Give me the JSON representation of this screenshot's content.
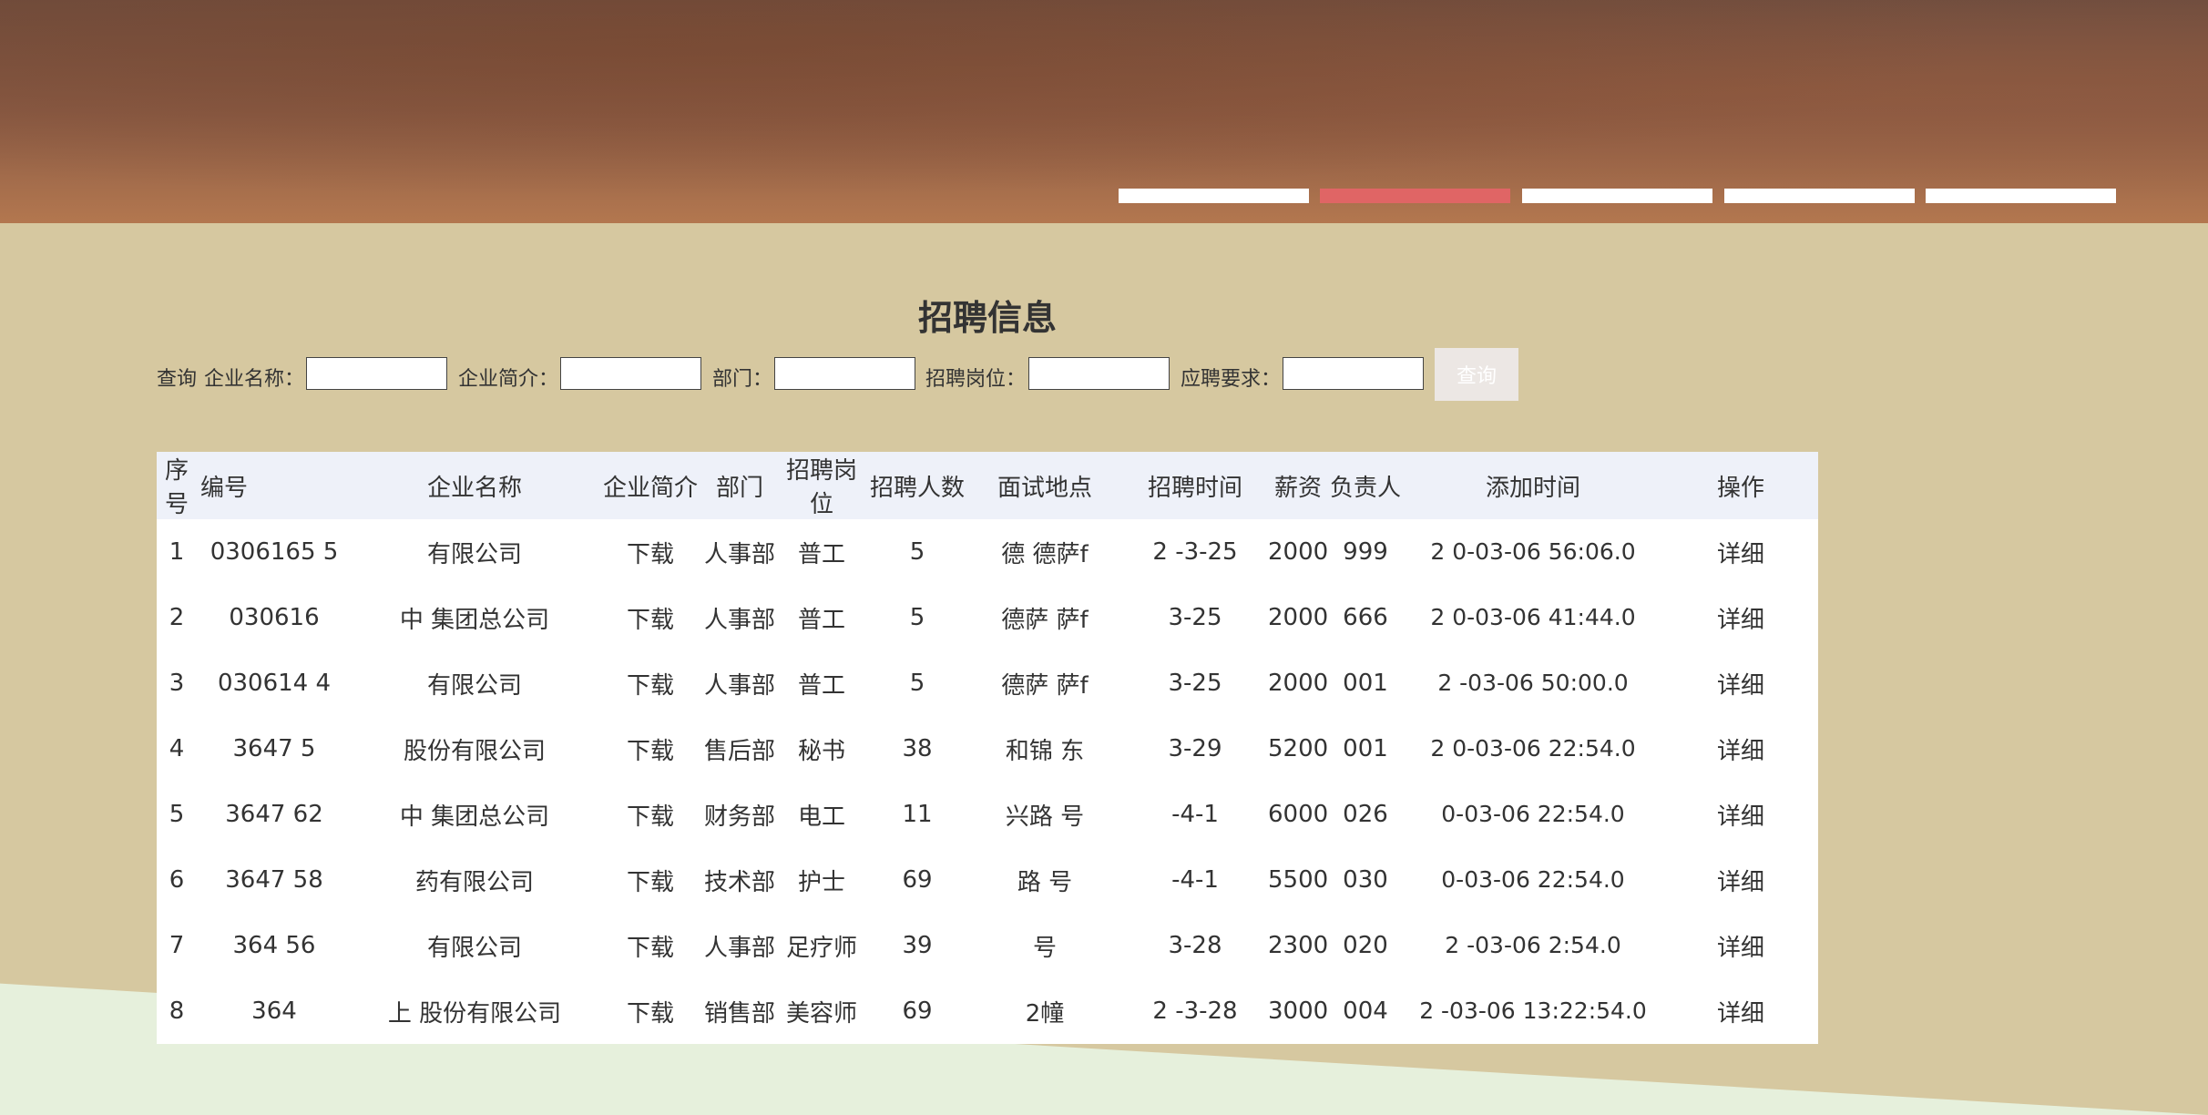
{
  "carousel": {
    "count": 5,
    "active_index": 1
  },
  "page_title": "招聘信息",
  "search": {
    "query_label": "查询",
    "fields": [
      {
        "label": "企业名称：",
        "value": ""
      },
      {
        "label": "企业简介：",
        "value": ""
      },
      {
        "label": "部门：",
        "value": ""
      },
      {
        "label": "招聘岗位：",
        "value": ""
      },
      {
        "label": "应聘要求：",
        "value": ""
      }
    ],
    "button_label": "查询"
  },
  "table": {
    "headers": [
      "序号",
      "编号",
      "企业名称",
      "企业简介",
      "部门",
      "招聘岗位",
      "招聘人数",
      "面试地点",
      "招聘时间",
      "薪资",
      "负责人",
      "添加时间",
      "操作"
    ],
    "rows": [
      [
        "1",
        "0306165 5",
        "有限公司",
        "下载",
        "人事部",
        "普工",
        "5",
        "德 德萨f",
        "2 -3-25",
        "2000",
        "999",
        "2 0-03-06 56:06.0",
        "详细"
      ],
      [
        "2",
        "030616",
        "中 集团总公司",
        "下载",
        "人事部",
        "普工",
        "5",
        "德萨 萨f",
        "3-25",
        "2000",
        "666",
        "2 0-03-06 41:44.0",
        "详细"
      ],
      [
        "3",
        "030614 4",
        "有限公司",
        "下载",
        "人事部",
        "普工",
        "5",
        "德萨 萨f",
        "3-25",
        "2000",
        "001",
        "2 -03-06 50:00.0",
        "详细"
      ],
      [
        "4",
        "3647 5",
        "股份有限公司",
        "下载",
        "售后部",
        "秘书",
        "38",
        "和锦 东",
        "3-29",
        "5200",
        "001",
        "2 0-03-06 22:54.0",
        "详细"
      ],
      [
        "5",
        "3647 62",
        "中 集团总公司",
        "下载",
        "财务部",
        "电工",
        "11",
        "兴路 号",
        "-4-1",
        "6000",
        "026",
        "0-03-06 22:54.0",
        "详细"
      ],
      [
        "6",
        "3647 58",
        "药有限公司",
        "下载",
        "技术部",
        "护士",
        "69",
        "路 号",
        "-4-1",
        "5500",
        "030",
        "0-03-06 22:54.0",
        "详细"
      ],
      [
        "7",
        "364 56",
        "有限公司",
        "下载",
        "人事部",
        "足疗师",
        "39",
        "号",
        "3-28",
        "2300",
        "020",
        "2 -03-06 2:54.0",
        "详细"
      ],
      [
        "8",
        "364",
        "上 股份有限公司",
        "下载",
        "销售部",
        "美容师",
        "69",
        "2幢",
        "2 -3-28",
        "3000",
        "004",
        "2 -03-06 13:22:54.0",
        "详细"
      ]
    ]
  },
  "colors": {
    "background": "#d6c8a0",
    "active_dot": "#e06565",
    "header_row": "#eef1f9"
  }
}
